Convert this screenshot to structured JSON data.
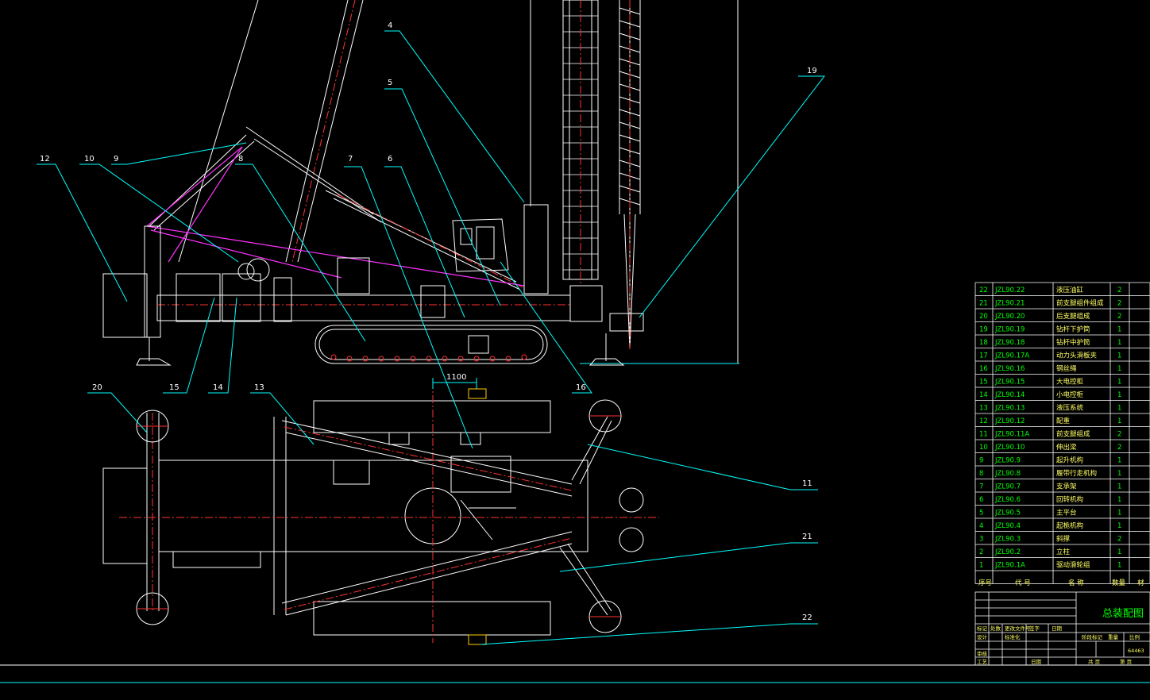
{
  "drawing": {
    "title": "总装配图",
    "drawing_number": "64463",
    "dimension": "1100",
    "callouts": [
      "4",
      "5",
      "19",
      "12",
      "10",
      "9",
      "8",
      "7",
      "6",
      "16",
      "15",
      "14",
      "13",
      "20",
      "11",
      "21",
      "22"
    ],
    "table_header": {
      "no": "序号",
      "code": "代  号",
      "name": "名  称",
      "qty": "数量",
      "mat": "材"
    },
    "parts": [
      {
        "no": "22",
        "code": "JZL90.22",
        "name": "液压油缸",
        "qty": "2"
      },
      {
        "no": "21",
        "code": "JZL90.21",
        "name": "前支腿组件组成",
        "qty": "2"
      },
      {
        "no": "20",
        "code": "JZL90.20",
        "name": "后支腿组成",
        "qty": "2"
      },
      {
        "no": "19",
        "code": "JZL90.19",
        "name": "钻杆下护筒",
        "qty": "1"
      },
      {
        "no": "18",
        "code": "JZL90.18",
        "name": "钻杆中护筒",
        "qty": "1"
      },
      {
        "no": "17",
        "code": "JZL90.17A",
        "name": "动力头滑板夹",
        "qty": "1"
      },
      {
        "no": "16",
        "code": "JZL90.16",
        "name": "钢丝绳",
        "qty": "1"
      },
      {
        "no": "15",
        "code": "JZL90.15",
        "name": "大电控柜",
        "qty": "1"
      },
      {
        "no": "14",
        "code": "JZL90.14",
        "name": "小电控柜",
        "qty": "1"
      },
      {
        "no": "13",
        "code": "JZL90.13",
        "name": "液压系统",
        "qty": "1"
      },
      {
        "no": "12",
        "code": "JZL90.12",
        "name": "配重",
        "qty": "1"
      },
      {
        "no": "11",
        "code": "JZL90.11A",
        "name": "前支腿组成",
        "qty": "2"
      },
      {
        "no": "10",
        "code": "JZL90.10",
        "name": "伸出梁",
        "qty": "2"
      },
      {
        "no": "9",
        "code": "JZL90.9",
        "name": "起升机构",
        "qty": "1"
      },
      {
        "no": "8",
        "code": "JZL90.8",
        "name": "履带行走机构",
        "qty": "1"
      },
      {
        "no": "7",
        "code": "JZL90.7",
        "name": "支承架",
        "qty": "1"
      },
      {
        "no": "6",
        "code": "JZL90.6",
        "name": "回转机构",
        "qty": "1"
      },
      {
        "no": "5",
        "code": "JZL90.5",
        "name": "主平台",
        "qty": "1"
      },
      {
        "no": "4",
        "code": "JZL90.4",
        "name": "起桅机构",
        "qty": "1"
      },
      {
        "no": "3",
        "code": "JZL90.3",
        "name": "斜撑",
        "qty": "2"
      },
      {
        "no": "2",
        "code": "JZL90.2",
        "name": "立柱",
        "qty": "1"
      },
      {
        "no": "1",
        "code": "JZL90.1A",
        "name": "驱动滑轮组",
        "qty": "1"
      }
    ],
    "titleblock": {
      "r1": [
        "标记",
        "处数",
        "更改文件号",
        "签字",
        "日期"
      ],
      "r2": [
        "设计",
        "标准化",
        "阶段标记",
        "重量",
        "比例"
      ],
      "r3": [
        "审核"
      ],
      "r4": [
        "工艺",
        "日期",
        "共  页",
        "第  页"
      ]
    }
  }
}
